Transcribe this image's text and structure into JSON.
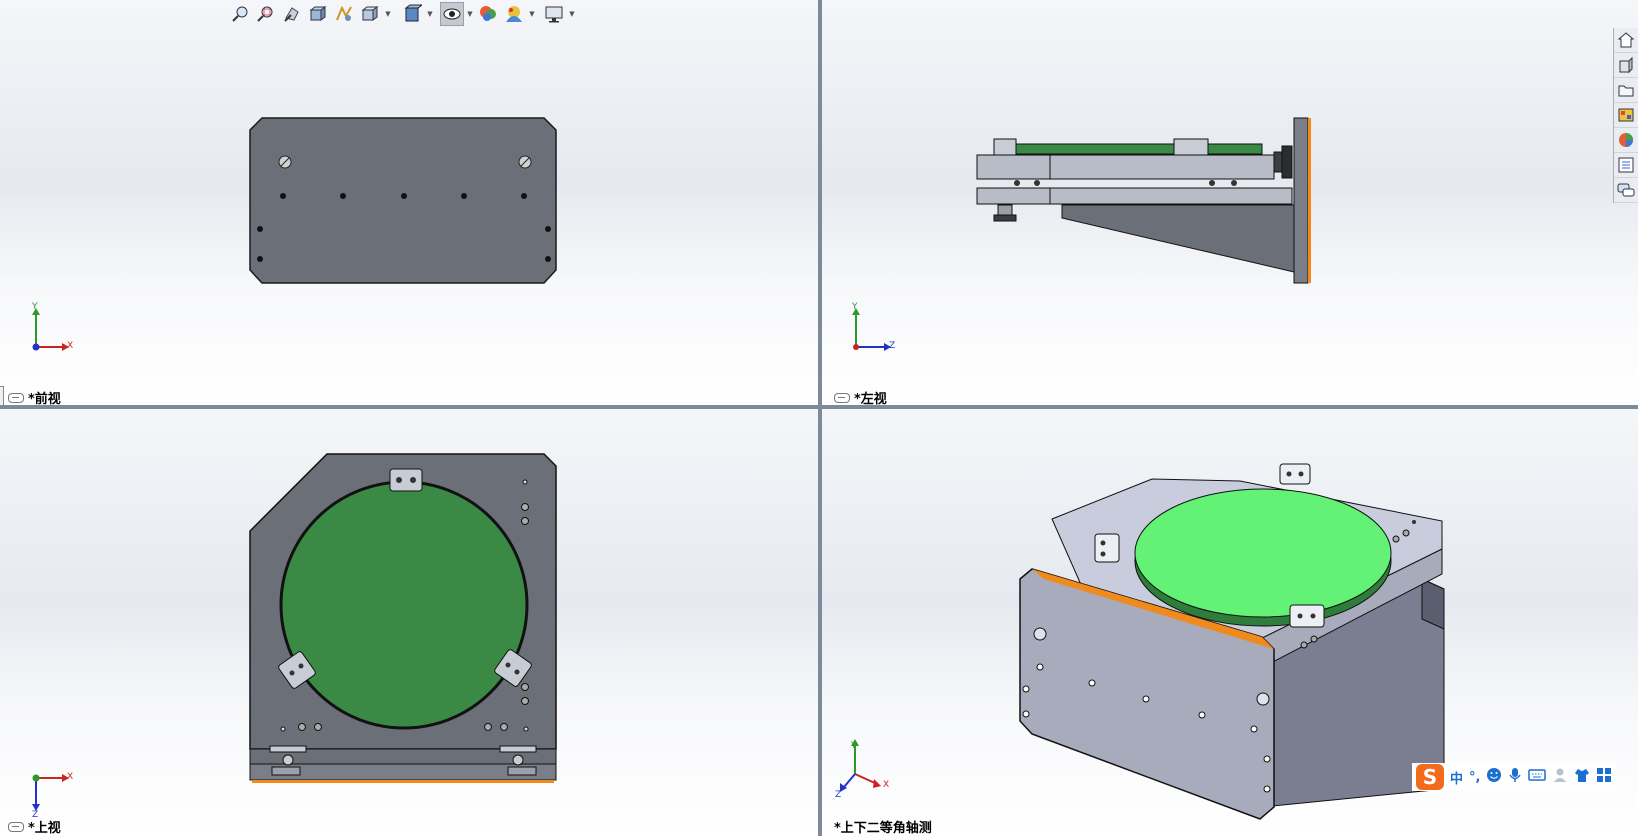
{
  "viewports": {
    "front": {
      "label": "*前视",
      "axes": {
        "x": "X",
        "y": "Y"
      }
    },
    "left": {
      "label": "*左视",
      "axes": {
        "y": "Y",
        "z": "Z"
      }
    },
    "top": {
      "label": "*上视",
      "axes": {
        "x": "X",
        "z": "Z"
      }
    },
    "iso": {
      "label": "*上下二等角轴测",
      "axes": {
        "x": "X",
        "y": "Y",
        "z": "Z"
      }
    }
  },
  "toolbar": {
    "icons": [
      "zoom-to-fit-icon",
      "zoom-to-area-icon",
      "previous-view-icon",
      "section-view-icon",
      "dynamic-annotation-icon",
      "view-orientation-icon",
      "display-style-icon",
      "hide-show-items-icon",
      "edit-appearance-icon",
      "apply-scene-icon",
      "view-settings-icon"
    ]
  },
  "taskpane": {
    "icons": [
      "home-icon",
      "parts-library-icon",
      "file-explorer-icon",
      "view-palette-icon",
      "appearances-icon",
      "custom-properties-icon",
      "forum-icon"
    ]
  },
  "ime": {
    "logo": "S",
    "mode": "中",
    "punct": "°,",
    "items": [
      "emoji-icon",
      "voice-icon",
      "keyboard-icon",
      "user-icon",
      "skin-icon",
      "toolbox-icon"
    ]
  },
  "colors": {
    "plate": "#6b6f78",
    "plate_dark": "#4c4f56",
    "green_top": "#3a8a45",
    "green_iso": "#63f275",
    "orange_edge": "#f08a1c",
    "iso_face": "#c8ccdc",
    "iso_side": "#a7abbb"
  }
}
